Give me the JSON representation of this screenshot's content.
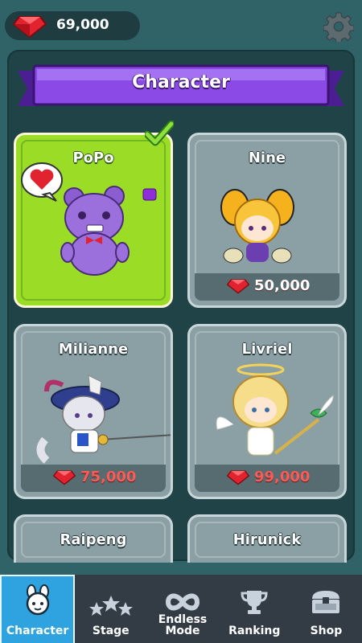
{
  "currency": {
    "amount": "69,000",
    "icon": "red-gem-icon",
    "gem_color": "#e0232e"
  },
  "header": {
    "title": "Character",
    "banner_color": "#7a3fd6"
  },
  "characters": [
    {
      "name": "PoPo",
      "price": "",
      "selected": true,
      "owned": true
    },
    {
      "name": "Nine",
      "price": "50,000",
      "selected": false
    },
    {
      "name": "Milianne",
      "price": "75,000",
      "selected": false
    },
    {
      "name": "Livriel",
      "price": "99,000",
      "selected": false
    },
    {
      "name": "Raipeng",
      "price": "",
      "selected": false
    },
    {
      "name": "Hirunick",
      "price": "",
      "selected": false
    }
  ],
  "nav": [
    {
      "label": "Character",
      "icon": "character-face-icon",
      "active": true
    },
    {
      "label": "Stage",
      "icon": "stars-icon"
    },
    {
      "label": "Endless Mode",
      "icon": "infinity-icon"
    },
    {
      "label": "Ranking",
      "icon": "trophy-icon"
    },
    {
      "label": "Shop",
      "icon": "treasure-chest-icon"
    }
  ],
  "colors": {
    "selected_card": "#9bdc26",
    "locked_card": "#8aa0a4",
    "nav_active": "#2ea3e0",
    "nav_bg": "#333c44"
  }
}
